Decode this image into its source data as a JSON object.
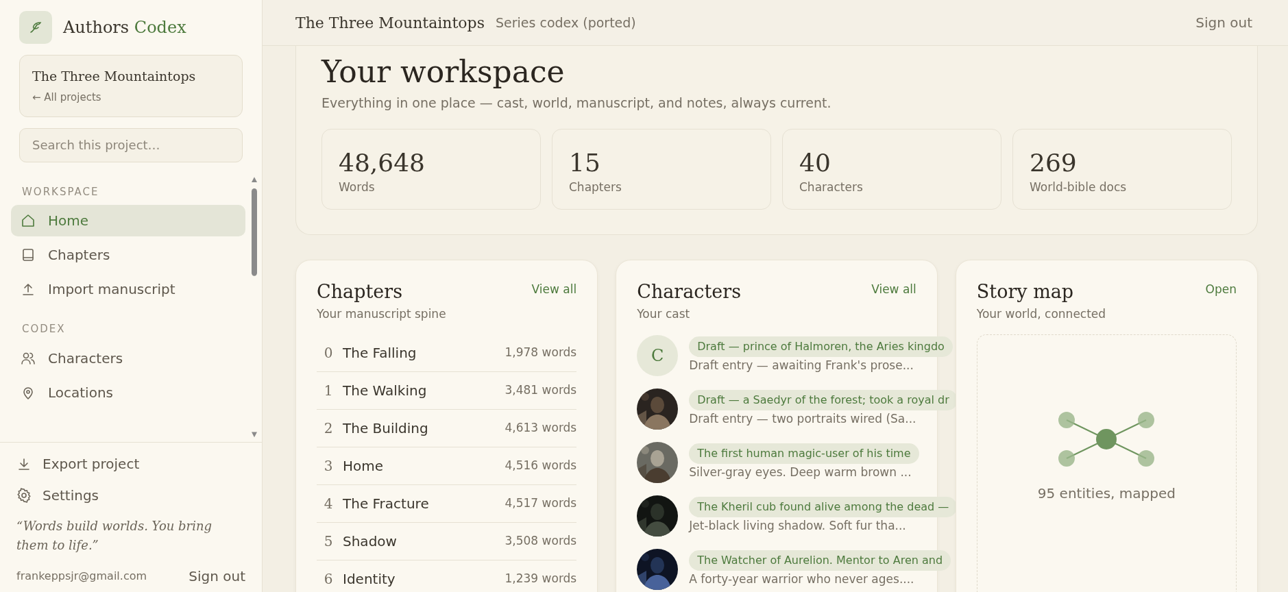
{
  "brand": {
    "name": "Authors",
    "accent": "Codex"
  },
  "project": {
    "title": "The Three Mountaintops",
    "back_link": "← All projects"
  },
  "search": {
    "placeholder": "Search this project…"
  },
  "nav_sections": [
    {
      "heading": "WORKSPACE",
      "items": [
        {
          "label": "Home",
          "kind": "home",
          "selected": true
        },
        {
          "label": "Chapters",
          "kind": "book",
          "selected": false
        },
        {
          "label": "Import manuscript",
          "kind": "upload",
          "selected": false
        }
      ]
    },
    {
      "heading": "CODEX",
      "items": [
        {
          "label": "Characters",
          "kind": "people",
          "selected": false
        },
        {
          "label": "Locations",
          "kind": "pin",
          "selected": false
        }
      ]
    }
  ],
  "footer_links": [
    {
      "label": "Export project",
      "kind": "download"
    },
    {
      "label": "Settings",
      "kind": "gear"
    }
  ],
  "quote": "“Words build worlds. You bring them to life.”",
  "user": {
    "email": "frankeppsjr@gmail.com",
    "sign_out": "Sign out"
  },
  "topbar": {
    "title": "The Three Mountaintops",
    "subtitle": "Series codex (ported)",
    "sign_out": "Sign out"
  },
  "workspace": {
    "title": "Your workspace",
    "subtitle": "Everything in one place — cast, world, manuscript, and notes, always current.",
    "stats": [
      {
        "value": "48,648",
        "label": "Words"
      },
      {
        "value": "15",
        "label": "Chapters"
      },
      {
        "value": "40",
        "label": "Characters"
      },
      {
        "value": "269",
        "label": "World-bible docs"
      }
    ]
  },
  "chapters_card": {
    "title": "Chapters",
    "subtitle": "Your manuscript spine",
    "action": "View all",
    "rows": [
      {
        "number": "0",
        "title": "The Falling",
        "words": "1,978 words"
      },
      {
        "number": "1",
        "title": "The Walking",
        "words": "3,481 words"
      },
      {
        "number": "2",
        "title": "The Building",
        "words": "4,613 words"
      },
      {
        "number": "3",
        "title": "Home",
        "words": "4,516 words"
      },
      {
        "number": "4",
        "title": "The Fracture",
        "words": "4,517 words"
      },
      {
        "number": "5",
        "title": "Shadow",
        "words": "3,508 words"
      },
      {
        "number": "6",
        "title": "Identity",
        "words": "1,239 words"
      }
    ]
  },
  "characters_card": {
    "title": "Characters",
    "subtitle": "Your cast",
    "action": "View all",
    "rows": [
      {
        "avatar": {
          "kind": "initial",
          "letter": "C"
        },
        "tag": "Draft — prince of Halmoren, the Aries kingdo",
        "summary": "Draft entry — awaiting Frank's prose..."
      },
      {
        "tag": "Draft — a Saedyr of the forest; took a royal dr",
        "summary": "Draft entry — two portraits wired (Sa..."
      },
      {
        "tag": "The first human magic-user of his time",
        "summary": "Silver-gray eyes. Deep warm brown ..."
      },
      {
        "tag": "The Kheril cub found alive among the dead —",
        "summary": "Jet-black living shadow. Soft fur tha..."
      },
      {
        "tag": "The Watcher of Aurelion. Mentor to Aren and",
        "summary": "A forty-year warrior who never ages...."
      }
    ]
  },
  "story_map_card": {
    "title": "Story map",
    "subtitle": "Your world, connected",
    "action": "Open",
    "caption": "95 entities, mapped"
  }
}
